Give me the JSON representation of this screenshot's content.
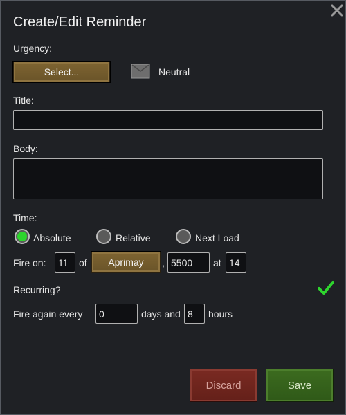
{
  "dialog": {
    "title": "Create/Edit Reminder"
  },
  "urgency": {
    "label": "Urgency:",
    "select_label": "Select...",
    "current": "Neutral"
  },
  "title_field": {
    "label": "Title:",
    "value": ""
  },
  "body_field": {
    "label": "Body:",
    "value": ""
  },
  "time": {
    "label": "Time:",
    "options": [
      "Absolute",
      "Relative",
      "Next Load"
    ],
    "selected": "Absolute"
  },
  "fire_on": {
    "label": "Fire on:",
    "day": "11",
    "of": "of",
    "month": "Aprimay",
    "comma": ",",
    "year": "5500",
    "at": "at",
    "hour": "14"
  },
  "recurring": {
    "label": "Recurring?",
    "checked": true
  },
  "fire_again": {
    "label": "Fire again every",
    "days": "0",
    "days_and": "days and",
    "hours": "8",
    "hours_label": "hours"
  },
  "buttons": {
    "discard": "Discard",
    "save": "Save"
  },
  "colors": {
    "accent_green": "#2ed52e",
    "discard_red": "#6e241c",
    "save_green": "#365f1c",
    "select_brown": "#735b2d"
  }
}
